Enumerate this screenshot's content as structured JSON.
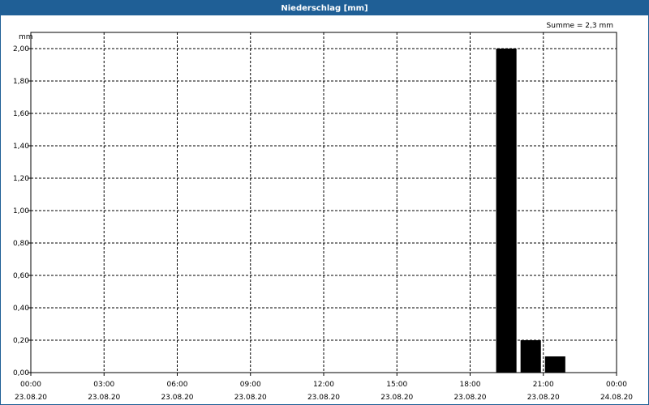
{
  "window": {
    "title": "Niederschlag [mm]"
  },
  "chart_data": {
    "type": "bar",
    "title": "Niederschlag [mm]",
    "ylabel": "mm",
    "annotation": "Summe = 2,3 mm",
    "ylim": [
      0,
      2.1
    ],
    "xlim_hours": [
      0,
      24
    ],
    "grid": true,
    "y_ticks": [
      "0,00",
      "0,20",
      "0,40",
      "0,60",
      "0,80",
      "1,00",
      "1,20",
      "1,40",
      "1,60",
      "1,80",
      "2,00"
    ],
    "x_ticks": [
      {
        "time": "00:00",
        "date": "23.08.20"
      },
      {
        "time": "03:00",
        "date": "23.08.20"
      },
      {
        "time": "06:00",
        "date": "23.08.20"
      },
      {
        "time": "09:00",
        "date": "23.08.20"
      },
      {
        "time": "12:00",
        "date": "23.08.20"
      },
      {
        "time": "15:00",
        "date": "23.08.20"
      },
      {
        "time": "18:00",
        "date": "23.08.20"
      },
      {
        "time": "21:00",
        "date": "23.08.20"
      },
      {
        "time": "00:00",
        "date": "24.08.20"
      }
    ],
    "bars": [
      {
        "x": "23.08.20 19:00-20:00",
        "value": 2.0
      },
      {
        "x": "23.08.20 20:00-21:00",
        "value": 0.2
      },
      {
        "x": "23.08.20 21:00-22:00",
        "value": 0.1
      }
    ],
    "colors": {
      "bar": "#000000",
      "grid": "#000000",
      "title_bar": "#1f5f96"
    }
  }
}
